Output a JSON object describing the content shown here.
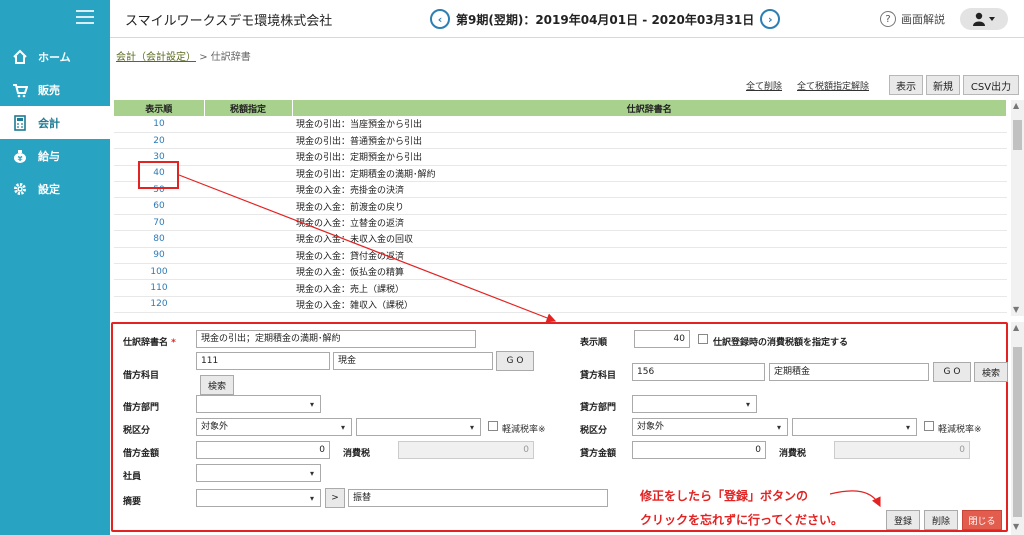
{
  "topbar": {
    "company": "スマイルワークスデモ環境株式会社",
    "period": "第9期(翌期)：2019年04月01日 - 2020年03月31日",
    "help": "画面解説",
    "prev_symbol": "‹",
    "next_symbol": "›"
  },
  "sidebar": {
    "items": [
      {
        "label": "ホーム",
        "icon": "home-icon"
      },
      {
        "label": "販売",
        "icon": "cart-icon"
      },
      {
        "label": "会計",
        "icon": "calculator-icon"
      },
      {
        "label": "給与",
        "icon": "money-bag-icon"
      },
      {
        "label": "設定",
        "icon": "gear-icon"
      }
    ]
  },
  "breadcrumb": {
    "link": "会計（会計設定）",
    "separator": ">",
    "current": "仕訳辞書"
  },
  "toolbar": {
    "delete_all": "全て削除",
    "delete_all_tax": "全て税額指定解除",
    "show": "表示",
    "new": "新規",
    "csv": "CSV出力"
  },
  "table": {
    "headers": [
      "表示順",
      "税額指定",
      "仕訳辞書名"
    ],
    "rows": [
      {
        "order": "10",
        "name": "現金の引出：当座預金から引出"
      },
      {
        "order": "20",
        "name": "現金の引出：普通預金から引出"
      },
      {
        "order": "30",
        "name": "現金の引出：定期預金から引出"
      },
      {
        "order": "40",
        "name": "現金の引出：定期積金の満期･解約"
      },
      {
        "order": "50",
        "name": "現金の入金：売掛金の決済"
      },
      {
        "order": "60",
        "name": "現金の入金：前渡金の戻り"
      },
      {
        "order": "70",
        "name": "現金の入金：立替金の返済"
      },
      {
        "order": "80",
        "name": "現金の入金：未収入金の回収"
      },
      {
        "order": "90",
        "name": "現金の入金：貸付金の返済"
      },
      {
        "order": "100",
        "name": "現金の入金：仮払金の精算"
      },
      {
        "order": "110",
        "name": "現金の入金：売上（課税）"
      },
      {
        "order": "120",
        "name": "現金の入金：雑収入（課税）"
      }
    ]
  },
  "form": {
    "name_label": "仕訳辞書名",
    "required_mark": "*",
    "name_value": "現金の引出；定期積金の満期･解約",
    "order_label": "表示順",
    "order_value": "40",
    "tax_check_label": "仕訳登録時の消費税額を指定する",
    "debit_account_label": "借方科目",
    "debit_code": "111",
    "debit_name": "現金",
    "go": "G O",
    "search": "検索",
    "credit_account_label": "貸方科目",
    "credit_code": "156",
    "credit_name": "定期積金",
    "debit_dept_label": "借方部門",
    "credit_dept_label": "貸方部門",
    "tax_class_label": "税区分",
    "tax_class_value": "対象外",
    "reduced_rate": "軽減税率※",
    "debit_amount_label": "借方金額",
    "debit_amount": "0",
    "consumption_tax_label": "消費税",
    "debit_tax": "0",
    "credit_amount_label": "貸方金額",
    "credit_amount": "0",
    "credit_tax": "0",
    "employee_label": "社員",
    "summary_label": "摘要",
    "summary_arrow": ">",
    "summary_value": "振替",
    "register": "登録",
    "delete": "削除",
    "close": "閉じる"
  },
  "annotation": {
    "line1": "修正をしたら「登録」ボタンの",
    "line2": "クリックを忘れずに行ってください。"
  },
  "colors": {
    "sidebar": "#29a3c2",
    "header_green": "#a9d18e",
    "accent_red": "#e32222",
    "link_blue": "#2b7bb9"
  }
}
